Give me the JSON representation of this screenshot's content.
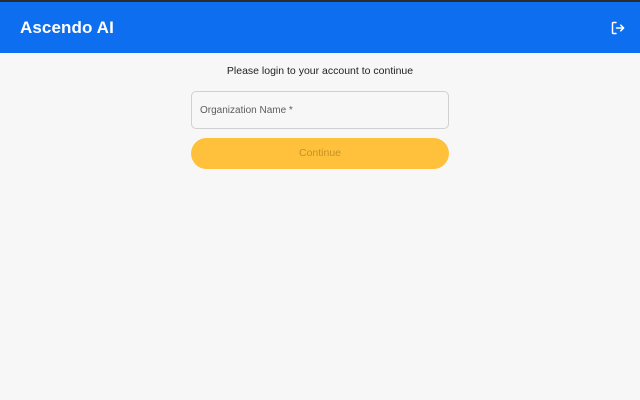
{
  "header": {
    "title": "Ascendo AI",
    "logout_icon": "logout-icon"
  },
  "login": {
    "prompt": "Please login to your account to continue",
    "org_field": {
      "placeholder": "Organization Name *",
      "value": ""
    },
    "continue_label": "Continue"
  },
  "colors": {
    "header_bg": "#0d6ef0",
    "button_bg": "#ffc13b",
    "button_text": "#c39125",
    "page_bg": "#f7f7f7"
  }
}
